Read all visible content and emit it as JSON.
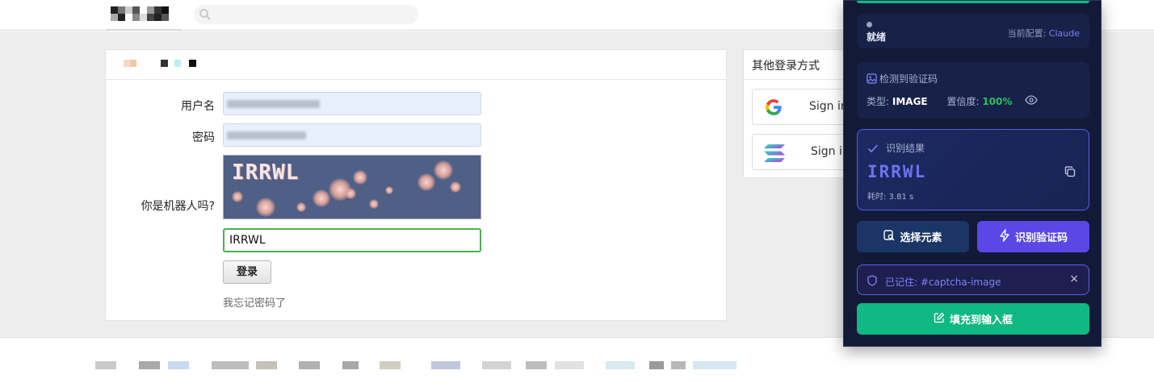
{
  "login_form": {
    "username_label": "用户名",
    "password_label": "密码",
    "captcha_label": "你是机器人吗?",
    "captcha_image_text": "IRRWL",
    "captcha_answer": "IRRWL",
    "login_button": "登录",
    "forgot_link": "我忘记密码了"
  },
  "other_login": {
    "title": "其他登录方式",
    "google_label": "Sign in",
    "solana_label": "Sign in"
  },
  "panel": {
    "status_text": "就绪",
    "config_label": "当前配置:",
    "config_value": "Claude",
    "detect_title": "检测到验证码",
    "type_label": "类型:",
    "type_value": "IMAGE",
    "confidence_label": "置信度:",
    "confidence_value": "100%",
    "result_title": "识别结果",
    "result_code": "IRRWL",
    "time_text": "耗时: 3.81 s",
    "select_button": "选择元素",
    "recognize_button": "识别验证码",
    "remembered_text": "已记住: #captcha-image",
    "close_symbol": "×",
    "fill_button": "填充到输入框"
  },
  "colors": {
    "accent_purple": "#5a47e6",
    "accent_green": "#10b981",
    "panel_bg": "#121a38"
  }
}
